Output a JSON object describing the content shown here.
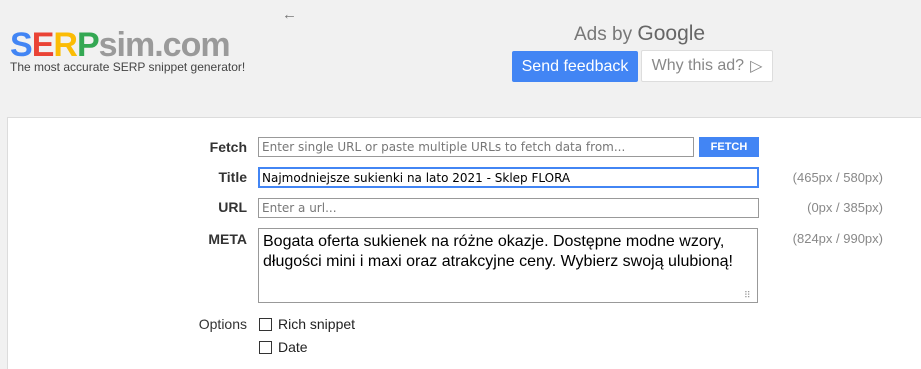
{
  "header": {
    "logo": {
      "s": "S",
      "e": "E",
      "r": "R",
      "p": "P",
      "rest": "sim.com"
    },
    "tagline": "The most accurate SERP snippet generator!",
    "back_arrow": "←"
  },
  "ads": {
    "label_prefix": "Ads by",
    "label_brand": "Google",
    "send_feedback": "Send feedback",
    "why_this_ad": "Why this ad?",
    "why_icon": "▷"
  },
  "form": {
    "fetch": {
      "label": "Fetch",
      "placeholder": "Enter single URL or paste multiple URLs to fetch data from...",
      "button": "FETCH"
    },
    "title": {
      "label": "Title",
      "value": "Najmodniejsze sukienki na lato 2021 - Sklep FLORA",
      "px_info": "(465px / 580px)"
    },
    "url": {
      "label": "URL",
      "placeholder": "Enter a url...",
      "px_info": "(0px / 385px)"
    },
    "meta": {
      "label": "META",
      "value": "Bogata oferta sukienek na różne okazje. Dostępne modne wzory, długości mini i maxi oraz atrakcyjne ceny. Wybierz swoją ulubioną!",
      "px_info": "(824px / 990px)"
    },
    "options": {
      "label": "Options",
      "items": [
        {
          "label": "Rich snippet",
          "checked": false
        },
        {
          "label": "Date",
          "checked": false
        }
      ]
    }
  }
}
